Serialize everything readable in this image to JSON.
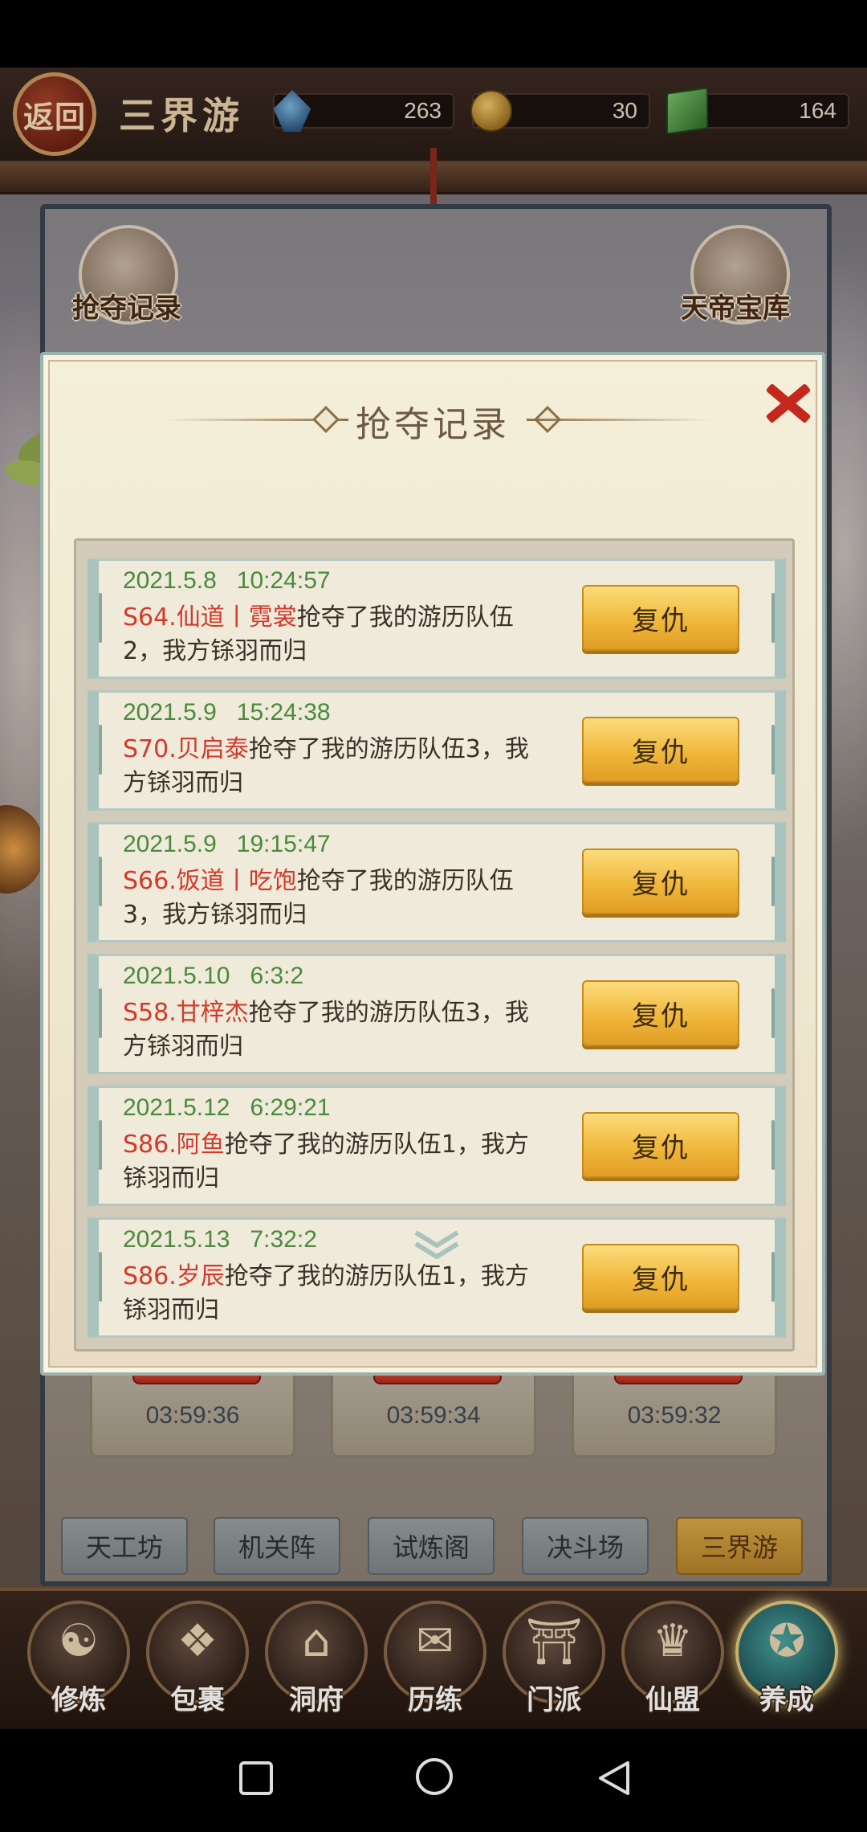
{
  "header": {
    "back_label": "返回",
    "title": "三界游",
    "resources": [
      {
        "icon": "crystal-icon",
        "value": "263"
      },
      {
        "icon": "coin-icon",
        "value": "30"
      },
      {
        "icon": "jade-book-icon",
        "value": "164"
      }
    ]
  },
  "background": {
    "left_button_label": "抢夺记录",
    "right_button_label": "天帝宝库",
    "timers": [
      "03:59:36",
      "03:59:34",
      "03:59:32"
    ],
    "tabs": [
      {
        "label": "天工坊"
      },
      {
        "label": "机关阵"
      },
      {
        "label": "试炼阁"
      },
      {
        "label": "决斗场"
      },
      {
        "label": "三界游"
      }
    ]
  },
  "modal": {
    "title": "抢夺记录",
    "records": [
      {
        "date": "2021.5.8   10:24:57",
        "name": "S64.仙道丨霓裳",
        "text": "抢夺了我的游历队伍2，我方铩羽而归",
        "button": "复仇"
      },
      {
        "date": "2021.5.9   15:24:38",
        "name": "S70.贝启泰",
        "text": "抢夺了我的游历队伍3，我方铩羽而归",
        "button": "复仇"
      },
      {
        "date": "2021.5.9   19:15:47",
        "name": "S66.饭道丨吃饱",
        "text": "抢夺了我的游历队伍3，我方铩羽而归",
        "button": "复仇"
      },
      {
        "date": "2021.5.10   6:3:2",
        "name": "S58.甘梓杰",
        "text": "抢夺了我的游历队伍3，我方铩羽而归",
        "button": "复仇"
      },
      {
        "date": "2021.5.12   6:29:21",
        "name": "S86.阿鱼",
        "text": "抢夺了我的游历队伍1，我方铩羽而归",
        "button": "复仇"
      },
      {
        "date": "2021.5.13   7:32:2",
        "name": "S86.岁辰",
        "text": "抢夺了我的游历队伍1，我方铩羽而归",
        "button": "复仇"
      }
    ]
  },
  "bottom_nav": [
    {
      "label": "修炼",
      "icon": "cultivator-icon"
    },
    {
      "label": "包裹",
      "icon": "bag-icon"
    },
    {
      "label": "洞府",
      "icon": "cave-house-icon"
    },
    {
      "label": "历练",
      "icon": "scroll-icon"
    },
    {
      "label": "门派",
      "icon": "sect-gate-icon"
    },
    {
      "label": "仙盟",
      "icon": "alliance-icon"
    },
    {
      "label": "养成",
      "icon": "pentagram-icon",
      "active": true
    }
  ],
  "colors": {
    "record_date": "#4a8a3c",
    "record_name": "#d13a2a",
    "revenge_button": "#f0b83c"
  }
}
